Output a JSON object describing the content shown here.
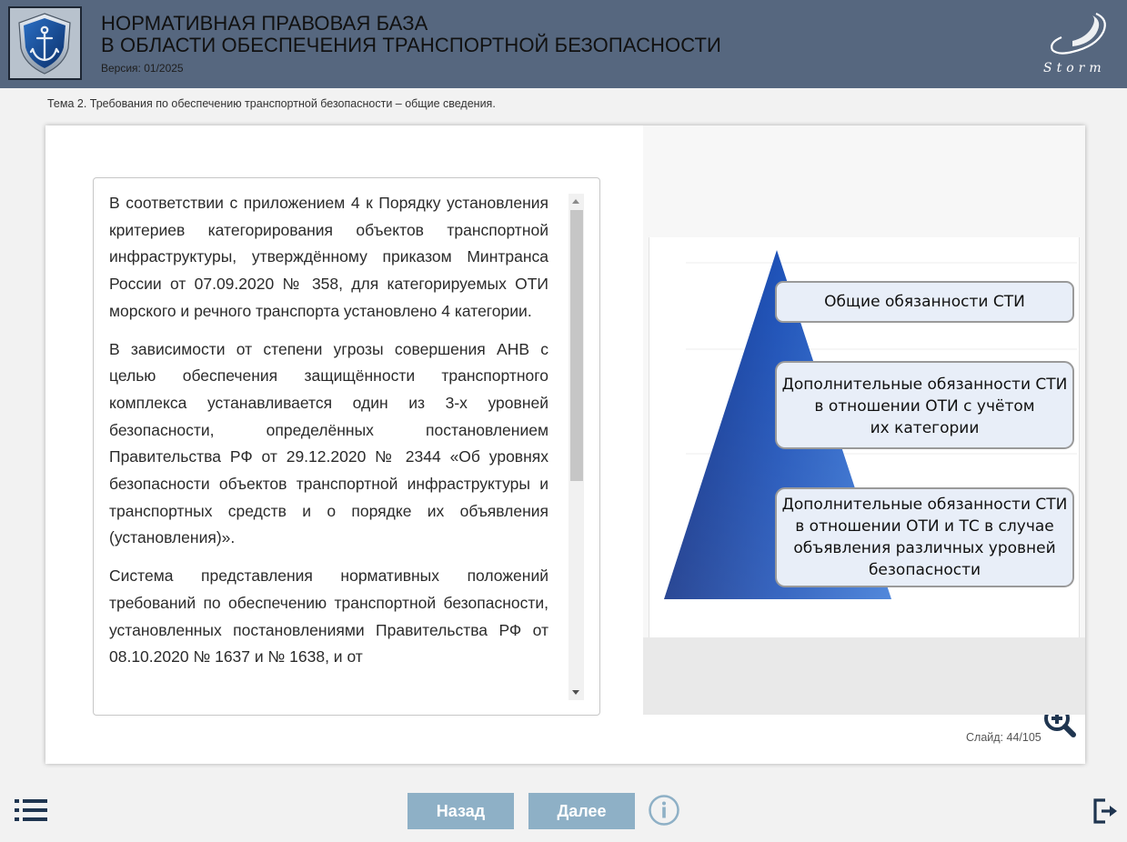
{
  "header": {
    "title_line1": "НОРМАТИВНАЯ ПРАВОВАЯ БАЗА",
    "title_line2": "В ОБЛАСТИ ОБЕСПЕЧЕНИЯ ТРАНСПОРТНОЙ БЕЗОПАСНОСТИ",
    "version": "Версия: 01/2025",
    "brand": "Storm"
  },
  "topic": "Тема 2. Требования по обеспечению транспортной безопасности – общие сведения.",
  "content": {
    "paragraphs": [
      "В соответствии с приложением 4 к Порядку установления критериев категорирования объектов транспортной инфраструктуры, утверждённому приказом Минтранса России от 07.09.2020 № 358, для категорируемых ОТИ морского и речного транспорта установлено 4 категории.",
      "В зависимости от степени угрозы совершения АНВ с целью обеспечения защищённости транспортного комплекса устанавливается один из 3-х уровней безопасности, определённых постановлением Правительства РФ от 29.12.2020 № 2344 «Об уровнях безопасности объектов транспортной инфраструктуры и транспортных средств и о порядке их объявления (установления)».",
      "Система представления нормативных положений требований по обеспечению транспортной безопасности, установленных постановлениями Правительства РФ от 08.10.2020 № 1637 и № 1638, и от"
    ]
  },
  "diagram": {
    "box1": "Общие обязанности СТИ",
    "box2_line1": "Дополнительные обязанности СТИ",
    "box2_line2": "в отношении ОТИ с учётом",
    "box2_line3": "их категории",
    "box3_line1": "Дополнительные обязанности СТИ",
    "box3_line2": "в отношении ОТИ и ТС в случае",
    "box3_line3": "объявления различных уровней",
    "box3_line4": "безопасности"
  },
  "slide_counter": "Слайд:  44/105",
  "nav": {
    "back_label": "Назад",
    "next_label": "Далее"
  },
  "colors": {
    "header_bg": "#56677f",
    "nav_button": "#8eb0c6",
    "pyramid": "#1a47a8",
    "icon": "#1f3550"
  },
  "icons": [
    "menu-list-icon",
    "info-icon",
    "exit-icon",
    "zoom-in-icon",
    "anchor-shield-icon"
  ]
}
